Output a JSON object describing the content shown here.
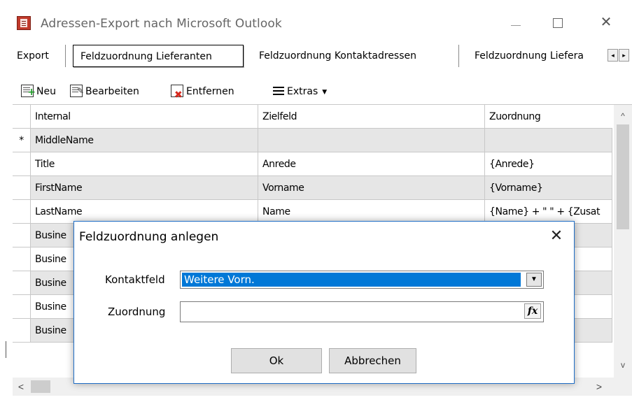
{
  "window": {
    "title": "Adressen-Export nach Microsoft Outlook",
    "minimize": "—",
    "maximize": "☐",
    "close": "✕"
  },
  "tabs": [
    {
      "label": "Export",
      "active": false
    },
    {
      "label": "Feldzuordnung Lieferanten",
      "active": true
    },
    {
      "label": "Feldzuordnung Kontaktadressen",
      "active": false
    },
    {
      "label": "Feldzuordnung Liefera",
      "active": false
    }
  ],
  "tab_scroll": {
    "left": "◂",
    "right": "▸"
  },
  "toolbar": {
    "new_label": "Neu",
    "edit_label": "Bearbeiten",
    "delete_label": "Entfernen",
    "extras_label": "Extras",
    "extras_caret": "▼"
  },
  "grid": {
    "columns": [
      "Internal",
      "Zielfeld",
      "Zuordnung"
    ],
    "new_row_marker": "*",
    "rows": [
      {
        "internal": "MiddleName",
        "zielfeld": "",
        "zuordnung": ""
      },
      {
        "internal": "Title",
        "zielfeld": "Anrede",
        "zuordnung": "{Anrede}"
      },
      {
        "internal": "FirstName",
        "zielfeld": "Vorname",
        "zuordnung": "{Vorname}"
      },
      {
        "internal": "LastName",
        "zielfeld": "Name",
        "zuordnung": "{Name} + \" \" + {Zusat"
      },
      {
        "internal": "Busine",
        "zielfeld": "",
        "zuordnung": ""
      },
      {
        "internal": "Busine",
        "zielfeld": "",
        "zuordnung": ""
      },
      {
        "internal": "Busine",
        "zielfeld": "",
        "zuordnung": ""
      },
      {
        "internal": "Busine",
        "zielfeld": "",
        "zuordnung": ""
      },
      {
        "internal": "Busine",
        "zielfeld": "",
        "zuordnung": ""
      }
    ],
    "scroll_up": "^",
    "scroll_down": "v",
    "scroll_left": "<",
    "scroll_right": ">"
  },
  "dialog": {
    "title": "Feldzuordnung anlegen",
    "close": "✕",
    "kontaktfeld_label": "Kontaktfeld",
    "kontaktfeld_value": "Weitere Vorn.",
    "zuordnung_label": "Zuordnung",
    "zuordnung_value": "",
    "fx_label": "fx",
    "ok_label": "Ok",
    "cancel_label": "Abbrechen"
  }
}
